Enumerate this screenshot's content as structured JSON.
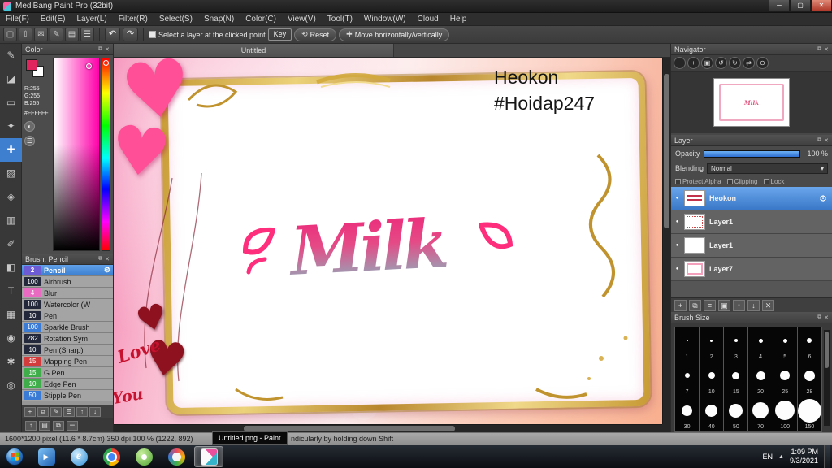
{
  "window": {
    "title": "MediBang Paint Pro (32bit)",
    "controls": {
      "minimize": "─",
      "maximize": "▢",
      "close": "✕"
    }
  },
  "menu": {
    "items": [
      "File(F)",
      "Edit(E)",
      "Layer(L)",
      "Filter(R)",
      "Select(S)",
      "Snap(N)",
      "Color(C)",
      "View(V)",
      "Tool(T)",
      "Window(W)",
      "Cloud",
      "Help"
    ]
  },
  "toolbar": {
    "icons": [
      {
        "name": "new-canvas-icon",
        "glyph": "▢"
      },
      {
        "name": "export-icon",
        "glyph": "⇧"
      },
      {
        "name": "comment-icon",
        "glyph": "✉"
      },
      {
        "name": "brush-icon",
        "glyph": "✎"
      },
      {
        "name": "pages-icon",
        "glyph": "▤"
      },
      {
        "name": "panels-icon",
        "glyph": "☰"
      }
    ],
    "undo_glyph": "↶",
    "redo_glyph": "↷",
    "select_layer_label": "Select a layer at the clicked point",
    "key_label": "Key",
    "reset_icon": "⟲",
    "reset_label": "Reset",
    "move_icon": "✚",
    "move_label": "Move horizontally/vertically"
  },
  "tools": [
    {
      "name": "pen-tool",
      "glyph": "✎"
    },
    {
      "name": "eraser-tool",
      "glyph": "◪"
    },
    {
      "name": "select-tool",
      "glyph": "▭"
    },
    {
      "name": "magic-wand-tool",
      "glyph": "✦"
    },
    {
      "name": "move-tool",
      "glyph": "✚",
      "active": true
    },
    {
      "name": "fill-tool",
      "glyph": "▨"
    },
    {
      "name": "bucket-tool",
      "glyph": "◈"
    },
    {
      "name": "gradient-tool",
      "glyph": "▥"
    },
    {
      "name": "select-pen-tool",
      "glyph": "✐"
    },
    {
      "name": "select-eraser-tool",
      "glyph": "◧"
    },
    {
      "name": "text-tool",
      "glyph": "T"
    },
    {
      "name": "frame-divide-tool",
      "glyph": "▦"
    },
    {
      "name": "eyedropper-tool",
      "glyph": "◉"
    },
    {
      "name": "hand-tool",
      "glyph": "✱"
    },
    {
      "name": "zoom-tool",
      "glyph": "◎"
    }
  ],
  "color_panel": {
    "title": "Color",
    "foreground": "#e0245e",
    "background": "#ffffff",
    "r": "R:255",
    "g": "G:255",
    "b": "B:255",
    "hex": "#FFFFFF"
  },
  "brush_panel": {
    "title": "Brush: Pencil",
    "brushes": [
      {
        "size": "2",
        "name": "Pencil",
        "badge": "#6c5bd4",
        "selected": true
      },
      {
        "size": "100",
        "name": "Airbrush",
        "badge": "#23293a"
      },
      {
        "size": "4",
        "name": "Blur",
        "badge": "#e86bc1"
      },
      {
        "size": "100",
        "name": "Watercolor (W",
        "badge": "#23293a"
      },
      {
        "size": "10",
        "name": "Pen",
        "badge": "#23293a"
      },
      {
        "size": "100",
        "name": "Sparkle Brush",
        "badge": "#3a7bd5"
      },
      {
        "size": "282",
        "name": "Rotation Sym",
        "badge": "#23293a"
      },
      {
        "size": "10",
        "name": "Pen (Sharp)",
        "badge": "#23293a"
      },
      {
        "size": "15",
        "name": "Mapping Pen",
        "badge": "#d23c3c"
      },
      {
        "size": "15",
        "name": "G Pen",
        "badge": "#3fae4a"
      },
      {
        "size": "10",
        "name": "Edge Pen",
        "badge": "#3fae4a"
      },
      {
        "size": "50",
        "name": "Stipple Pen",
        "badge": "#3a7bd5"
      }
    ],
    "footer_icons": [
      {
        "name": "add-brush-icon",
        "glyph": "+"
      },
      {
        "name": "duplicate-brush-icon",
        "glyph": "⧉"
      },
      {
        "name": "edit-brush-icon",
        "glyph": "✎"
      },
      {
        "name": "brush-menu-icon",
        "glyph": "☰"
      },
      {
        "name": "brush-up-icon",
        "glyph": "↑"
      },
      {
        "name": "brush-down-icon",
        "glyph": "↓"
      }
    ]
  },
  "left_footer_icons": [
    {
      "name": "dock-up-icon",
      "glyph": "↑"
    },
    {
      "name": "page-icon",
      "glyph": "▤"
    },
    {
      "name": "pages-icon",
      "glyph": "⧉"
    },
    {
      "name": "dock-menu-icon",
      "glyph": "☰"
    }
  ],
  "canvas": {
    "tab": "Untitled",
    "overlay_line1": "Heokon",
    "overlay_line2": "#Hoidap247",
    "title_word": "Milk",
    "love_word": "Love",
    "you_word": "You"
  },
  "navigator": {
    "title": "Navigator",
    "zoom_buttons": [
      {
        "name": "zoom-out-button",
        "glyph": "−"
      },
      {
        "name": "zoom-in-button",
        "glyph": "+"
      },
      {
        "name": "fit-window-button",
        "glyph": "▣"
      },
      {
        "name": "rotate-left-button",
        "glyph": "↺"
      },
      {
        "name": "rotate-right-button",
        "glyph": "↻"
      },
      {
        "name": "flip-button",
        "glyph": "⇄"
      },
      {
        "name": "reset-view-button",
        "glyph": "⊙"
      }
    ]
  },
  "layer_panel": {
    "title": "Layer",
    "opacity_label": "Opacity",
    "opacity_value": "100 %",
    "blending_label": "Blending",
    "blending_value": "Normal",
    "checkboxes": [
      "Protect Alpha",
      "Clipping",
      "Lock"
    ],
    "layers": [
      {
        "name": "Heokon",
        "selected": true,
        "thumb": "t-text"
      },
      {
        "name": "Layer1",
        "thumb": "t-red-frame"
      },
      {
        "name": "Layer1",
        "thumb": "t-plain"
      },
      {
        "name": "Layer7",
        "thumb": "t-pink-frame"
      }
    ],
    "footer_icons": [
      {
        "name": "add-layer-icon",
        "glyph": "+"
      },
      {
        "name": "duplicate-layer-icon",
        "glyph": "⧉"
      },
      {
        "name": "merge-layer-icon",
        "glyph": "≡"
      },
      {
        "name": "layer-folder-icon",
        "glyph": "▣"
      },
      {
        "name": "layer-up-icon",
        "glyph": "↑"
      },
      {
        "name": "layer-down-icon",
        "glyph": "↓"
      },
      {
        "name": "delete-layer-icon",
        "glyph": "✕"
      }
    ]
  },
  "brush_size_panel": {
    "title": "Brush Size",
    "rows": [
      [
        1,
        2,
        3,
        4,
        5,
        6
      ],
      [
        7,
        10,
        15,
        20,
        25,
        28
      ],
      [
        30,
        40,
        50,
        70,
        100,
        150
      ]
    ]
  },
  "status_bar": {
    "info": "1600*1200 pixel  (11.6 * 8.7cm)   350 dpi   100 %   (1222, 892)",
    "tooltip": "Untitled.png - Paint",
    "hint": "ndicularly by holding down Shift"
  },
  "taskbar": {
    "apps": [
      {
        "name": "media-app",
        "style": "ic-media",
        "glyph": "▶"
      },
      {
        "name": "internet-explorer",
        "style": "ic-ie",
        "glyph": "e"
      },
      {
        "name": "chrome",
        "style": "ic-chrome"
      },
      {
        "name": "coccoc-browser",
        "style": "ic-coccoc"
      },
      {
        "name": "paint-app",
        "style": "ic-ring"
      },
      {
        "name": "medibang-paint",
        "style": "ic-medibang",
        "active": true
      }
    ],
    "tray": {
      "lang": "EN",
      "arrow": "▲",
      "time": "1:09 PM",
      "date": "9/3/2021"
    }
  }
}
